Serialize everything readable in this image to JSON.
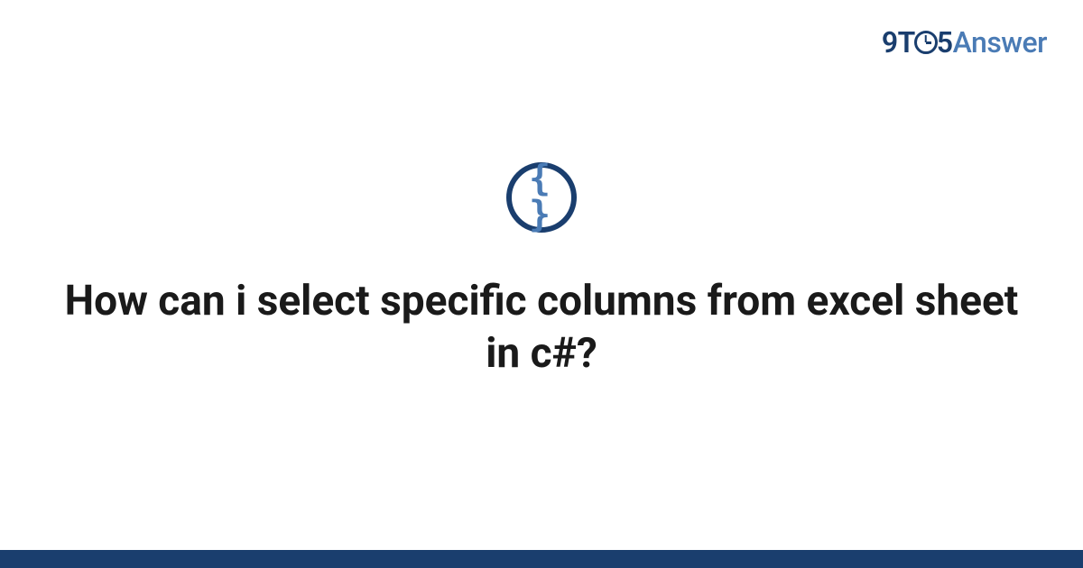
{
  "logo": {
    "part1": "9T",
    "part2": "5",
    "part3": "Answer"
  },
  "icon": {
    "braces": "{ }"
  },
  "question": {
    "title": "How can i select specific columns from excel sheet in c#?"
  }
}
